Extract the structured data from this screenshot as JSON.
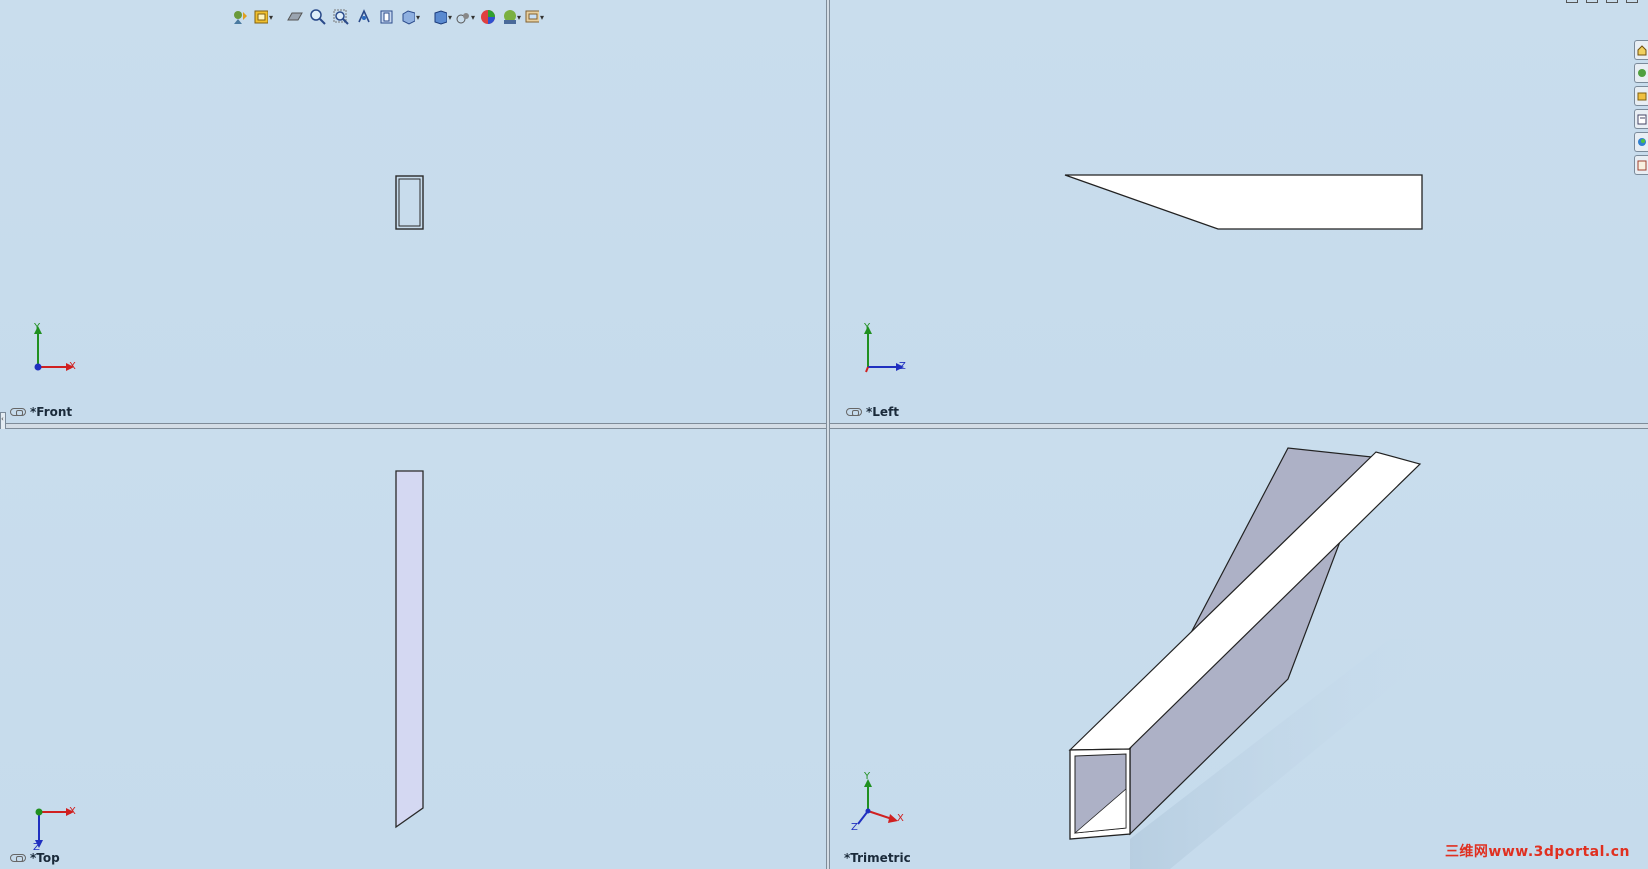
{
  "views": {
    "front": {
      "label": "*Front",
      "axis_h": "X",
      "axis_v": "Y"
    },
    "left": {
      "label": "*Left",
      "axis_h": "Z",
      "axis_v": "Y"
    },
    "top": {
      "label": "*Top",
      "axis_h": "X",
      "axis_v": "Z"
    },
    "trimetric": {
      "label": "*Trimetric",
      "axis_x": "X",
      "axis_y": "Y",
      "axis_z": "Z"
    }
  },
  "toolbar": {
    "icons": [
      "previous-view-icon",
      "standard-views-icon",
      "section-view-icon",
      "zoom-to-fit-icon",
      "zoom-to-area-icon",
      "rotate-view-icon",
      "view-orientation-icon",
      "display-style-icon",
      "hide-show-items-icon",
      "edit-appearance-icon",
      "apply-scene-icon",
      "view-settings-icon"
    ]
  },
  "task_pane": {
    "icons": [
      "home-icon",
      "design-library-icon",
      "file-explorer-icon",
      "view-palette-icon",
      "appearances-icon",
      "custom-properties-icon"
    ]
  },
  "watermark": "三维网www.3dportal.cn",
  "colors": {
    "viewport_bg": "#c8dcec",
    "axis_x": "#d02020",
    "axis_y": "#209020",
    "axis_z": "#2030c0",
    "part_face_light": "#ffffff",
    "part_face_shade": "#adb1c6",
    "top_view_face": "#d4d8f2"
  }
}
